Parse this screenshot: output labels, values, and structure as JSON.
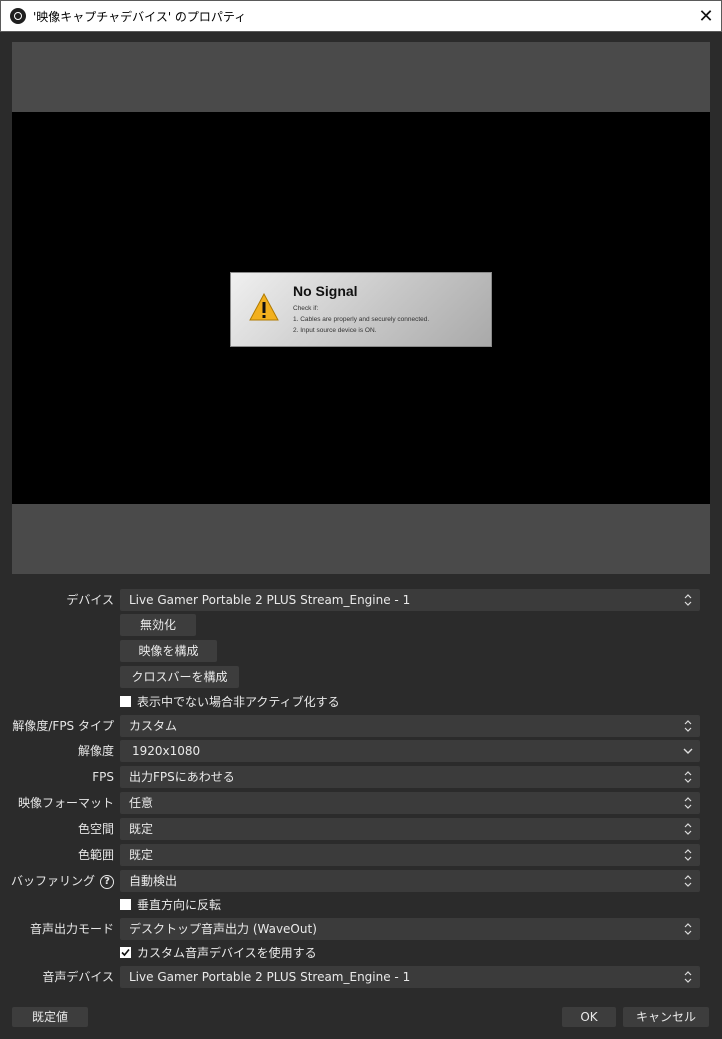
{
  "window": {
    "title": "'映像キャプチャデバイス' のプロパティ",
    "close_glyph": "✕"
  },
  "preview": {
    "no_signal_title": "No Signal",
    "no_signal_check": "Check if:",
    "no_signal_line1": "1. Cables are properly and securely connected.",
    "no_signal_line2": "2. Input source device is ON."
  },
  "form": {
    "device_label": "デバイス",
    "device_value": "Live Gamer Portable 2 PLUS Stream_Engine - 1",
    "deactivate_button": "無効化",
    "configure_video_button": "映像を構成",
    "configure_crossbar_button": "クロスバーを構成",
    "deactivate_hidden_label": "表示中でない場合非アクティブ化する",
    "deactivate_hidden_checked": false,
    "res_type_label": "解像度/FPS タイプ",
    "res_type_value": "カスタム",
    "resolution_label": "解像度",
    "resolution_value": "1920x1080",
    "fps_label": "FPS",
    "fps_value": "出力FPSにあわせる",
    "video_format_label": "映像フォーマット",
    "video_format_value": "任意",
    "color_space_label": "色空間",
    "color_space_value": "既定",
    "color_range_label": "色範囲",
    "color_range_value": "既定",
    "buffering_label": "バッファリング",
    "buffering_value": "自動検出",
    "flip_vertical_label": "垂直方向に反転",
    "flip_vertical_checked": false,
    "audio_output_label": "音声出力モード",
    "audio_output_value": "デスクトップ音声出力 (WaveOut)",
    "custom_audio_label": "カスタム音声デバイスを使用する",
    "custom_audio_checked": true,
    "audio_device_label": "音声デバイス",
    "audio_device_value": "Live Gamer Portable 2 PLUS Stream_Engine - 1"
  },
  "footer": {
    "defaults_button": "既定値",
    "ok_button": "OK",
    "cancel_button": "キャンセル"
  },
  "colors": {
    "background": "#2b2b2b",
    "control": "#3b3b3b",
    "preview_bg": "#4a4a4a"
  }
}
